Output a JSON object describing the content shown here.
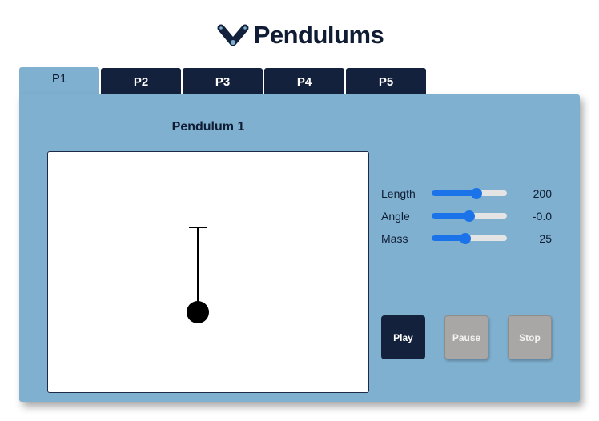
{
  "app": {
    "title": "Pendulums",
    "colors": {
      "navy": "#14213d",
      "panel": "#7fb0d0",
      "slider": "#1a73e8",
      "disabled_button": "#a9a6a6"
    }
  },
  "tabs": [
    {
      "label": "P1",
      "active": true
    },
    {
      "label": "P2",
      "active": false
    },
    {
      "label": "P3",
      "active": false
    },
    {
      "label": "P4",
      "active": false
    },
    {
      "label": "P5",
      "active": false
    }
  ],
  "panel": {
    "title": "Pendulum 1"
  },
  "controls": {
    "length": {
      "label": "Length",
      "value": "200",
      "fraction": 0.6
    },
    "angle": {
      "label": "Angle",
      "value": "-0.0",
      "fraction": 0.5
    },
    "mass": {
      "label": "Mass",
      "value": "25",
      "fraction": 0.45
    }
  },
  "buttons": {
    "play": "Play",
    "pause": "Pause",
    "stop": "Stop"
  }
}
